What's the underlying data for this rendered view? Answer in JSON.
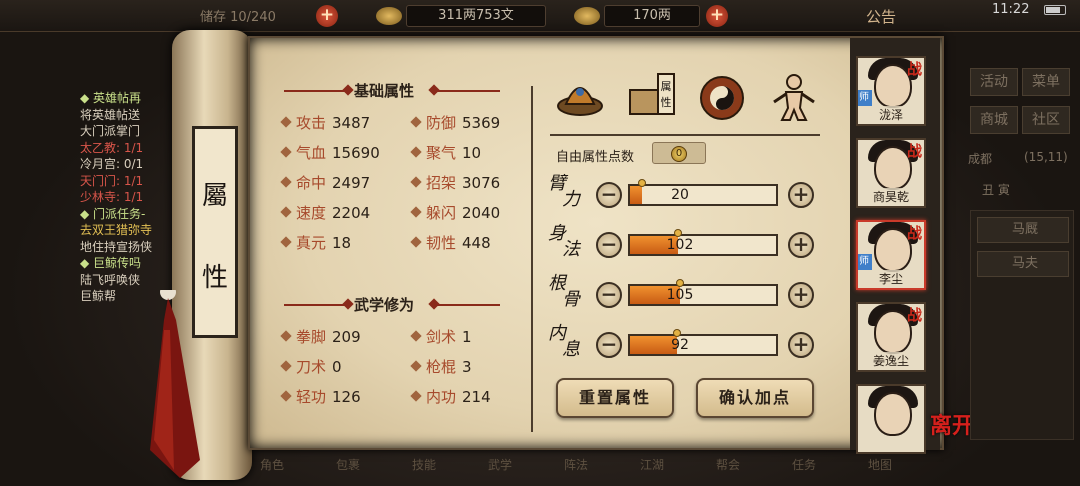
{
  "topbar": {
    "left_text": "储存 10/240",
    "money": "311两753文",
    "gold": "170两",
    "notice": "公告",
    "clock": "11:22"
  },
  "quests": [
    {
      "text": "◆ 英雄帖再",
      "style": "q-head"
    },
    {
      "text": "将英雄帖送",
      "style": "q-white"
    },
    {
      "text": "大门派掌门",
      "style": "q-white"
    },
    {
      "text": "太乙教: 1/1",
      "style": "q-red"
    },
    {
      "text": "冷月宫: 0/1",
      "style": "q-white"
    },
    {
      "text": "天门门: 1/1",
      "style": "q-red"
    },
    {
      "text": "少林寺: 1/1",
      "style": "q-red"
    },
    {
      "text": "◆ 门派任务-",
      "style": "q-head"
    },
    {
      "text": "去双王猎弥寺",
      "style": "q-yellow"
    },
    {
      "text": "地住持宣扬侠",
      "style": "q-white"
    },
    {
      "text": "◆ 巨鲸传吗",
      "style": "q-head"
    },
    {
      "text": "陆飞呼唤侠",
      "style": "q-white"
    },
    {
      "text": "巨鲸帮",
      "style": "q-white"
    }
  ],
  "scroll": {
    "char1": "屬",
    "char2": "性"
  },
  "basic": {
    "title": "基础属性",
    "left": [
      {
        "label": "攻击",
        "value": "3487"
      },
      {
        "label": "气血",
        "value": "15690"
      },
      {
        "label": "命中",
        "value": "2497"
      },
      {
        "label": "速度",
        "value": "2204"
      },
      {
        "label": "真元",
        "value": "18"
      }
    ],
    "right": [
      {
        "label": "防御",
        "value": "5369"
      },
      {
        "label": "聚气",
        "value": "10"
      },
      {
        "label": "招架",
        "value": "3076"
      },
      {
        "label": "躲闪",
        "value": "2040"
      },
      {
        "label": "韧性",
        "value": "448"
      }
    ]
  },
  "martial": {
    "title": "武学修为",
    "left": [
      {
        "label": "拳脚",
        "value": "209"
      },
      {
        "label": "刀术",
        "value": "0"
      },
      {
        "label": "轻功",
        "value": "126"
      }
    ],
    "right": [
      {
        "label": "剑术",
        "value": "1"
      },
      {
        "label": "枪棍",
        "value": "3"
      },
      {
        "label": "内功",
        "value": "214"
      }
    ]
  },
  "tabs": {
    "attr_label": "属性"
  },
  "free_points": {
    "label": "自由属性点数",
    "value": "0"
  },
  "attributes": [
    {
      "name": "臂力",
      "value": "20",
      "fill": 0.08
    },
    {
      "name": "身法",
      "value": "102",
      "fill": 0.33
    },
    {
      "name": "根骨",
      "value": "105",
      "fill": 0.34
    },
    {
      "name": "内息",
      "value": "92",
      "fill": 0.32
    }
  ],
  "buttons": {
    "reset": "重置属性",
    "confirm": "确认加点"
  },
  "heroes": [
    {
      "name": "泷泽",
      "zhan": "战",
      "teacher": "师",
      "active": false
    },
    {
      "name": "商昊乾",
      "zhan": "战",
      "teacher": "",
      "active": false
    },
    {
      "name": "李尘",
      "zhan": "战",
      "teacher": "师",
      "active": true
    },
    {
      "name": "姜逸尘",
      "zhan": "战",
      "teacher": "",
      "active": false
    },
    {
      "name": "",
      "zhan": "",
      "teacher": "",
      "active": false
    }
  ],
  "leave": "离开",
  "rmenu": {
    "b1": "活动",
    "b2": "菜单",
    "b3": "商城",
    "b4": "社区",
    "loc": "成都",
    "coords": "(15,11)",
    "time": "丑 寅"
  },
  "rlist": {
    "i1": "马厩",
    "i2": "马夫"
  },
  "bottombar": {
    "b1": "角色",
    "b2": "包裹",
    "b3": "技能",
    "b4": "武学",
    "b5": "阵法",
    "b6": "江湖",
    "b7": "帮会",
    "b8": "任务",
    "b9": "地图"
  }
}
